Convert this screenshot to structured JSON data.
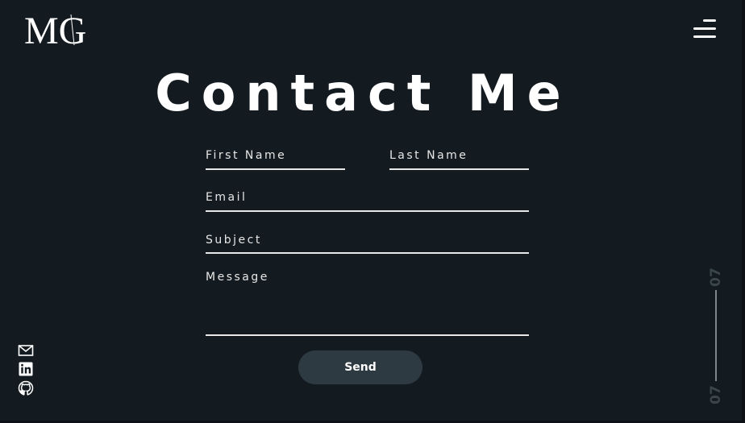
{
  "header": {
    "logo_text": "MG",
    "menu_icon": "hamburger-menu-icon"
  },
  "main": {
    "title": "Contact Me",
    "form": {
      "first_name_placeholder": "First Name",
      "last_name_placeholder": "Last Name",
      "email_placeholder": "Email",
      "subject_placeholder": "Subject",
      "message_placeholder": "Message",
      "send_label": "Send"
    }
  },
  "social": {
    "icons": [
      "mail-icon",
      "linkedin-icon",
      "github-icon"
    ]
  },
  "page_indicator": {
    "current": "07",
    "total": "07"
  },
  "colors": {
    "background": "#141b20",
    "button": "#2d3a42",
    "text": "#ffffff",
    "indicator": "#3a454c"
  }
}
